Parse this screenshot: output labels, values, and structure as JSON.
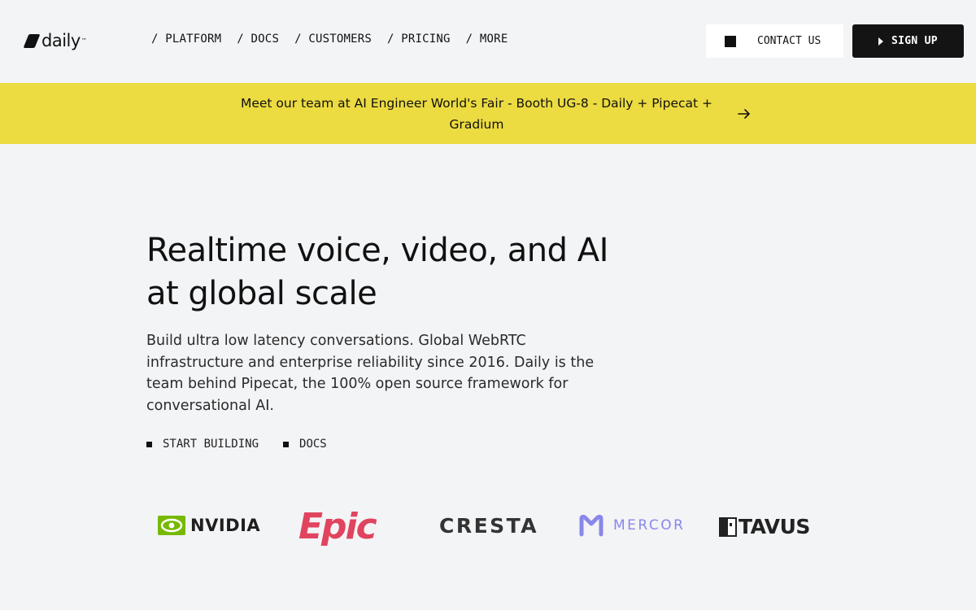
{
  "header": {
    "logo_text": "daily",
    "logo_tm": "™",
    "nav": [
      {
        "label": "/ PLATFORM"
      },
      {
        "label": "/ DOCS"
      },
      {
        "label": "/ CUSTOMERS"
      },
      {
        "label": "/ PRICING"
      },
      {
        "label": "/ MORE"
      }
    ],
    "contact_label": "CONTACT US",
    "signup_label": "SIGN UP"
  },
  "banner": {
    "text": "Meet our team at AI Engineer World's Fair - Booth UG-8 - Daily + Pipecat + Gradium"
  },
  "hero": {
    "title": "Realtime voice, video, and AI at global scale",
    "description": "Build ultra low latency conversations. Global WebRTC infrastructure and enterprise reliability since 2016. Daily is the team behind Pipecat, the 100% open source framework for conversational AI.",
    "actions": [
      {
        "label": "START BUILDING"
      },
      {
        "label": "DOCS"
      }
    ]
  },
  "logos": {
    "nvidia": "NVIDIA",
    "epic": "Epic",
    "cresta": "CRESTA",
    "mercor": "MERCOR",
    "tavus": "TAVUS"
  },
  "colors": {
    "background": "#f3f4f6",
    "banner": "#ecdb41",
    "signup_bg": "#141414",
    "nvidia_green": "#76b900",
    "epic_red": "#e0445f",
    "mercor_purple": "#8a87ea"
  }
}
